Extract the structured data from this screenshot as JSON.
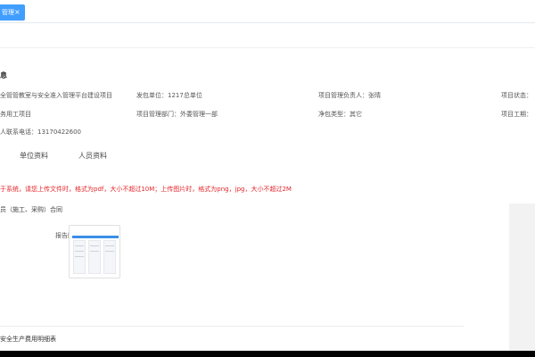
{
  "tab": {
    "label": "管理",
    "close": "×"
  },
  "section": {
    "title": "息"
  },
  "info": {
    "project_name": "全管管教室与安全准入管理平台建设项目",
    "contractor": "发包单位：1217总单位",
    "manager": "项目管理负责人：张晴",
    "status": "项目状态：",
    "type": "务用工项目",
    "dept": "项目管理部门：外委管理一部",
    "scope": "净包类型：其它",
    "period": "项目工期：",
    "phone": "人联系电话：13170422600"
  },
  "subtabs": {
    "unit": "单位资料",
    "people": "人员资料"
  },
  "notice": "于系统，请您上传文件时，格式为pdf，大小不超过10M；上传图片时，格式为png，jpg，大小不超过2M",
  "contract": "员（施工、采购）合同",
  "report": {
    "label": "报告附件："
  },
  "bottom": {
    "title": "安全生产费用明细表"
  },
  "colors": {
    "accent": "#409eff",
    "warning": "#e3262b"
  },
  "icons": {
    "close": "close-icon",
    "thumbnail": "document-thumbnail-icon"
  }
}
